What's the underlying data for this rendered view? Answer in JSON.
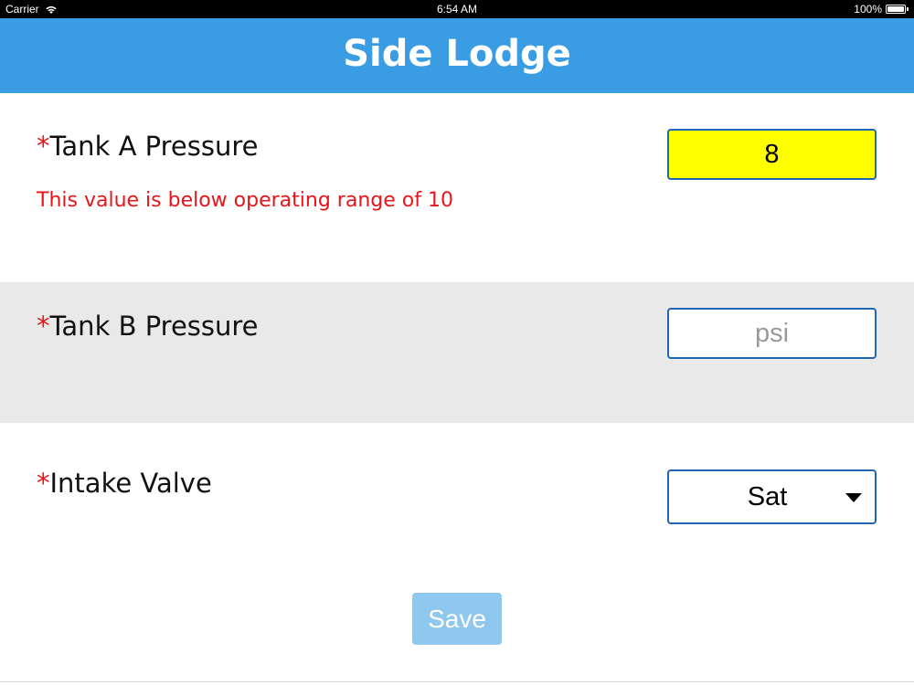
{
  "status_bar": {
    "carrier": "Carrier",
    "time": "6:54 AM",
    "battery": "100%",
    "icons": [
      "wifi-icon",
      "battery-icon"
    ]
  },
  "nav": {
    "title": "Side Lodge",
    "color": "#3a9de3"
  },
  "form": {
    "required_marker": "*",
    "tank_a": {
      "label": "Tank A Pressure",
      "value": "8",
      "error": "This value is below operating range of 10",
      "highlight_color": "#ffff00"
    },
    "tank_b": {
      "label": "Tank B Pressure",
      "value": "",
      "placeholder": "psi"
    },
    "intake_valve": {
      "label": "Intake Valve",
      "selected": "Sat"
    },
    "save_label": "Save"
  },
  "colors": {
    "error": "#e8151b",
    "input_border": "#1f66b3",
    "save_button_disabled": "#8ec8ef",
    "alt_row": "#e9e9e9"
  }
}
